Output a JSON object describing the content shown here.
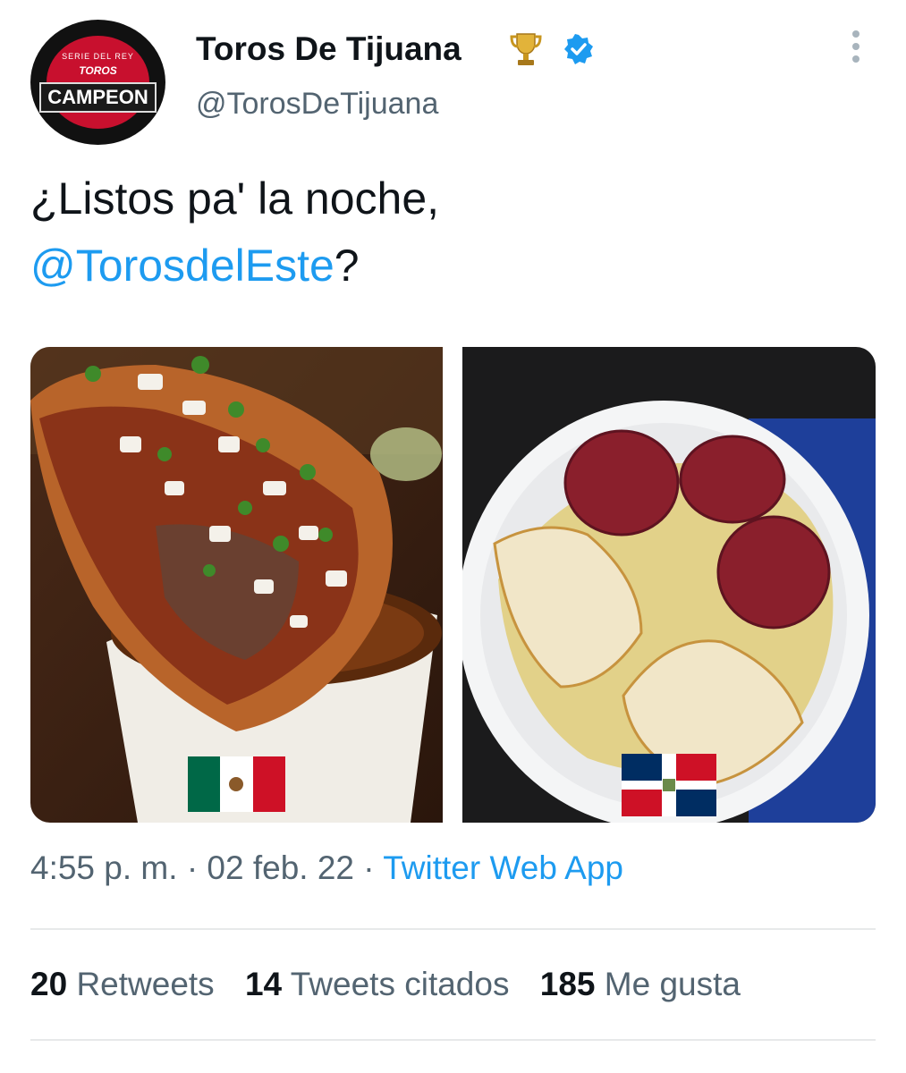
{
  "author": {
    "avatar_lines": [
      "SERIE DEL REY",
      "TOROS",
      "CAMPEON"
    ],
    "name": "Toros De Tijuana",
    "handle": "@TorosDeTijuana",
    "badges": [
      "trophy-icon",
      "verified-icon"
    ]
  },
  "tweet": {
    "text_before": "¿Listos pa' la noche,",
    "mention": "@TorosdelEste",
    "text_after": "?",
    "images": [
      {
        "subject": "birria taco dipped in consomé",
        "flag": "mexico-flag"
      },
      {
        "subject": "mangú plate with salami and fried cheese",
        "flag": "dominican-republic-flag"
      }
    ]
  },
  "meta": {
    "time": "4:55 p. m.",
    "sep": "·",
    "date": "02 feb. 22",
    "app": "Twitter Web App"
  },
  "stats": [
    {
      "count": "20",
      "label": "Retweets"
    },
    {
      "count": "14",
      "label": "Tweets citados"
    },
    {
      "count": "185",
      "label": "Me gusta"
    }
  ],
  "colors": {
    "accent": "#1d9bf0",
    "secondary_text": "#536471",
    "divider": "#e7e9ea"
  }
}
